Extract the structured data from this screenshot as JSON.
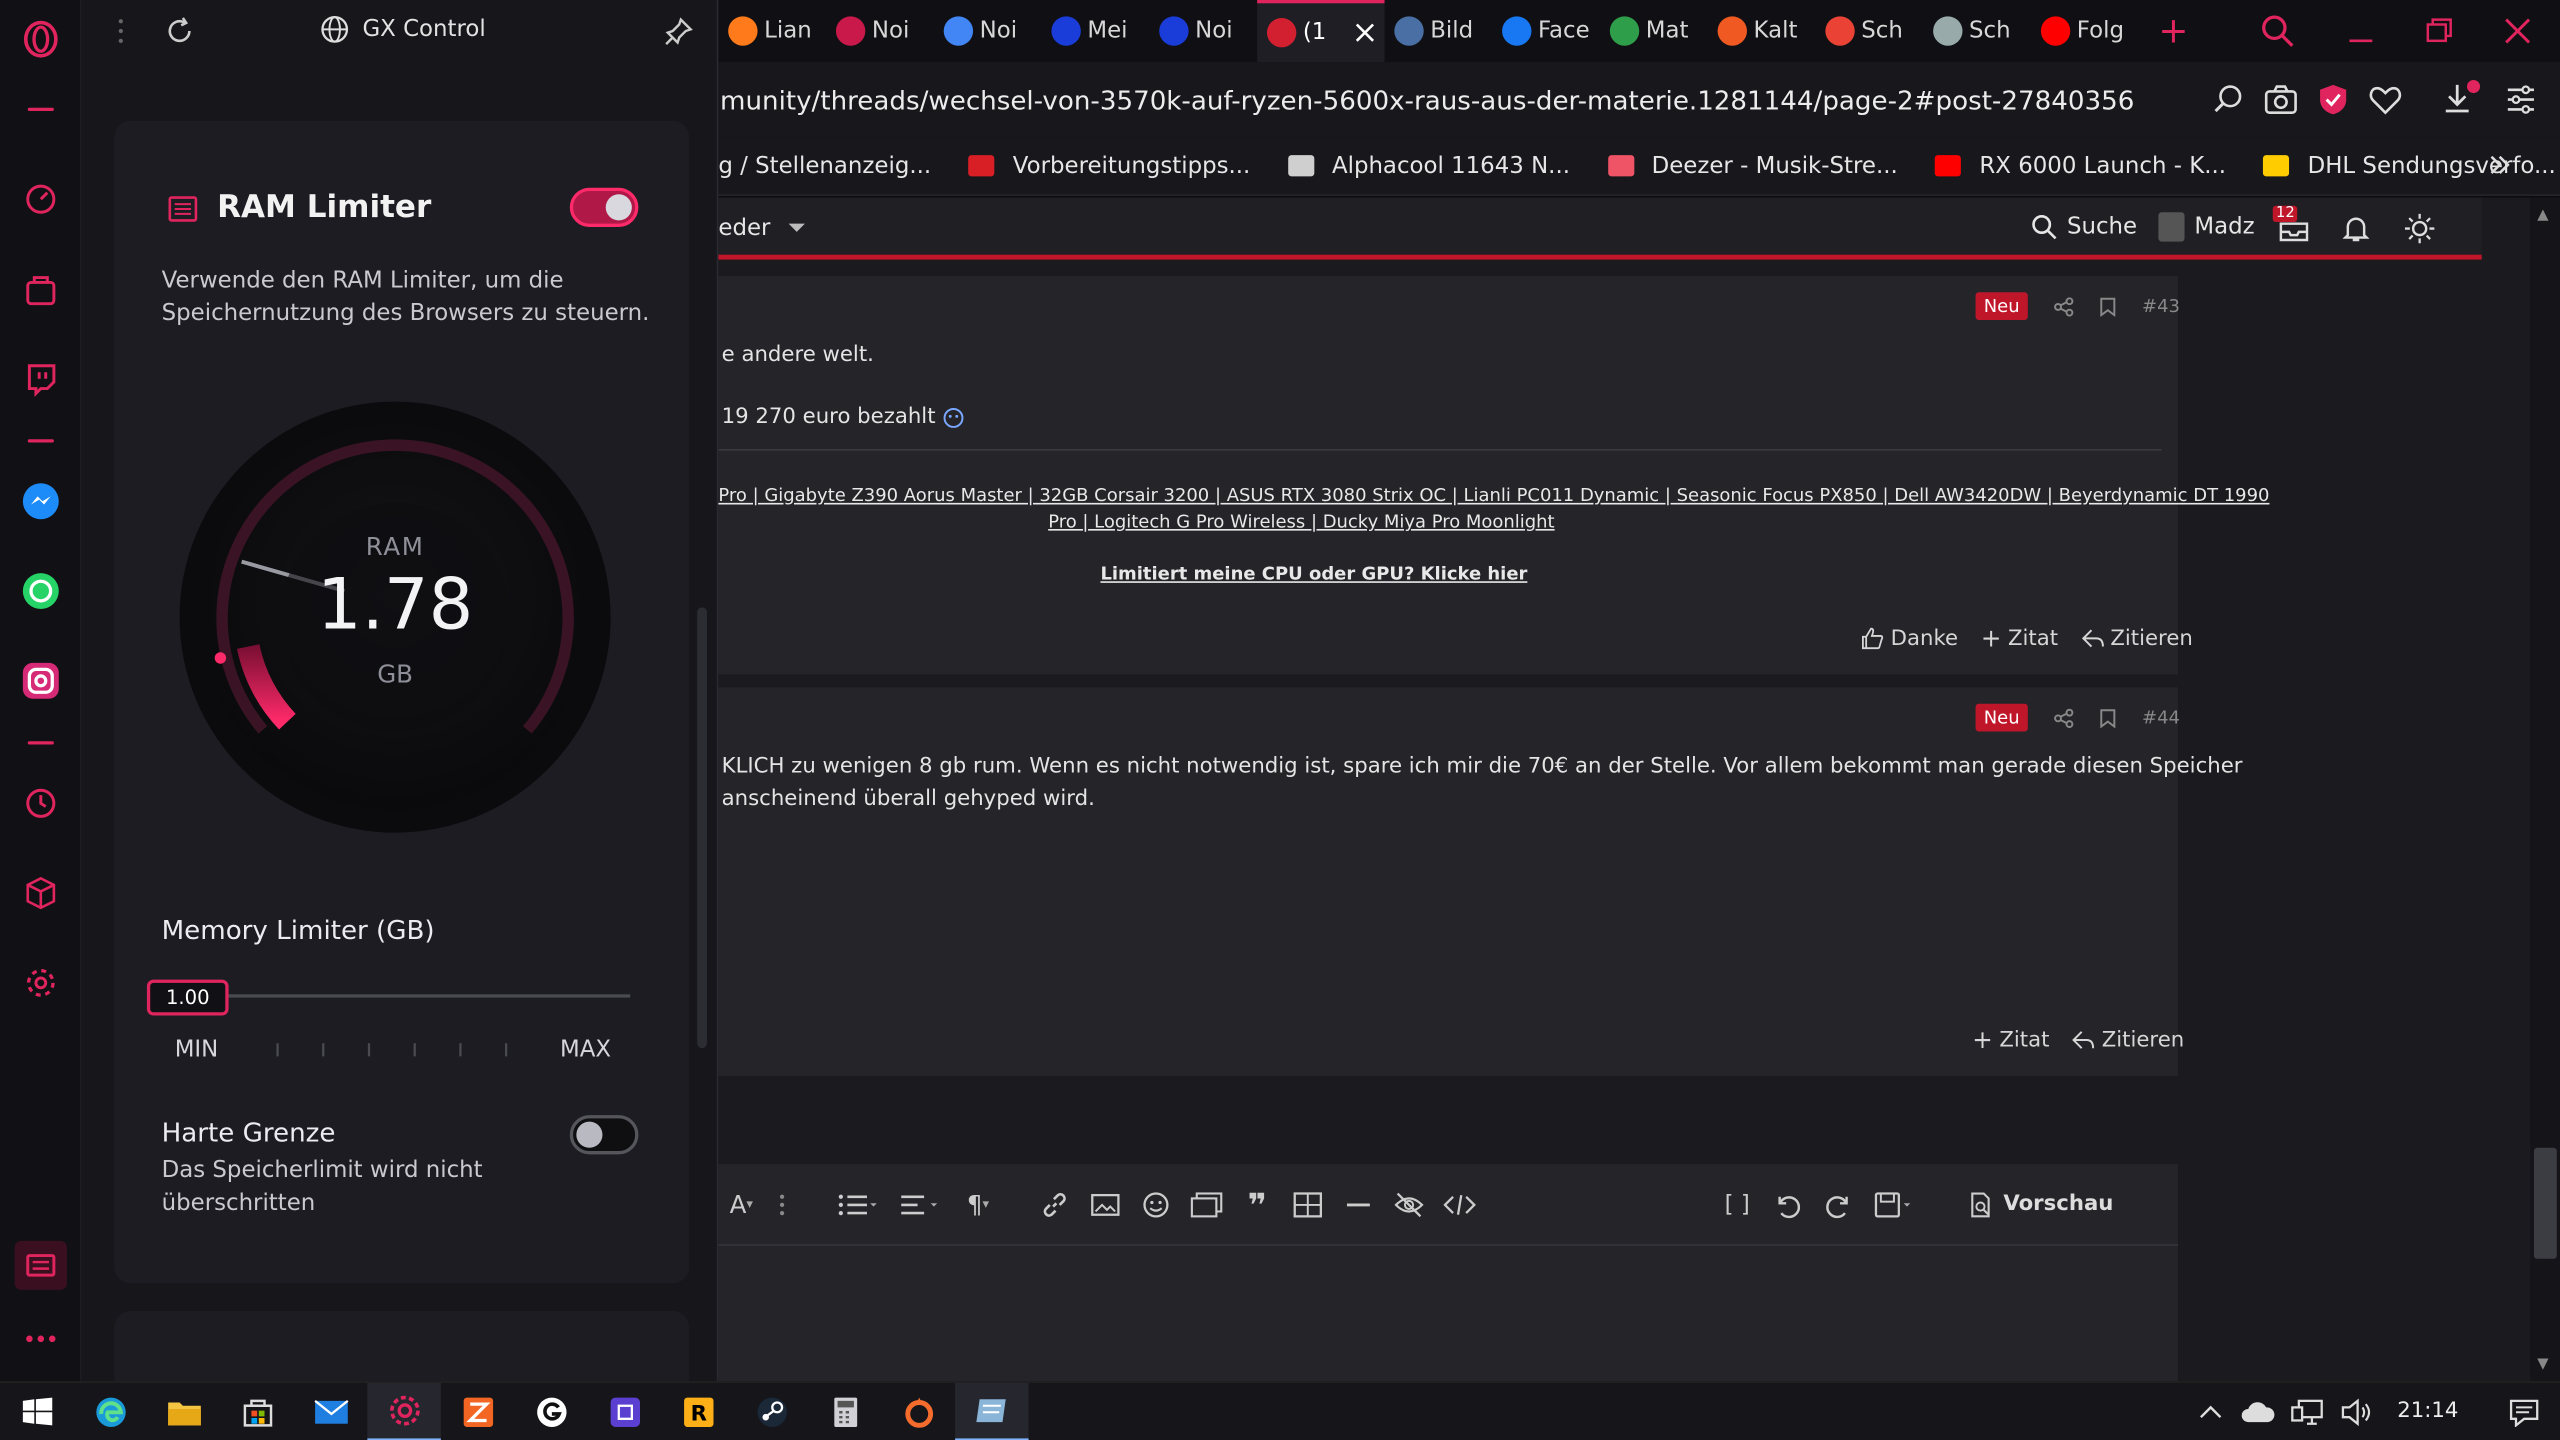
{
  "gx": {
    "panel_title": "GX Control",
    "ram": {
      "title": "RAM Limiter",
      "enabled": true,
      "description_line1": "Verwende den RAM Limiter, um die",
      "description_line2": "Speichernutzung des Browsers zu steuern.",
      "gauge_label": "RAM",
      "gauge_value": "1.78",
      "gauge_unit": "GB",
      "limiter_label": "Memory Limiter (GB)",
      "limiter_value": "1.00",
      "slider_fraction": 0.0,
      "min_label": "MIN",
      "max_label": "MAX",
      "hard_limit_title": "Harte Grenze",
      "hard_limit_enabled": false,
      "hard_limit_desc_line1": "Das Speicherlimit wird nicht",
      "hard_limit_desc_line2": "überschritten"
    }
  },
  "tabs": [
    {
      "label": "Lian",
      "icon": "lianli-icon",
      "color": "#ff7a1a"
    },
    {
      "label": "Noi",
      "icon": "noisebridge-icon",
      "color": "#c9184a"
    },
    {
      "label": "Noi",
      "icon": "google-icon",
      "color": "#4285f4"
    },
    {
      "label": "Mei",
      "icon": "mein-icon",
      "color": "#1a3dd9"
    },
    {
      "label": "Noi",
      "icon": "noise-icon",
      "color": "#1a3dd9"
    },
    {
      "label": "(1",
      "icon": "computerbase-icon",
      "color": "#d32030",
      "active": true
    },
    {
      "label": "Bild",
      "icon": "bild-icon",
      "color": "#4a6fa5"
    },
    {
      "label": "Face",
      "icon": "facebook-icon",
      "color": "#1877f2"
    },
    {
      "label": "Mat",
      "icon": "mat-icon",
      "color": "#2e9e4a"
    },
    {
      "label": "Kalt",
      "icon": "kalt-icon",
      "color": "#f05a22"
    },
    {
      "label": "Sch",
      "icon": "gmail-icon",
      "color": "#ea4335"
    },
    {
      "label": "Sch",
      "icon": "satellite-icon",
      "color": "#9aa"
    },
    {
      "label": "Folg",
      "icon": "youtube-icon",
      "color": "#ff0000"
    }
  ],
  "address": {
    "url": "munity/threads/wechsel-von-3570k-auf-ryzen-5600x-raus-aus-der-materie.1281144/page-2#post-27840356"
  },
  "bookmarks": [
    {
      "label": "g / Stellenanzeig...",
      "icon": "",
      "color": ""
    },
    {
      "label": "Vorbereitungstipps...",
      "icon": "bookmark-r-icon",
      "color": "#d81f26"
    },
    {
      "label": "Alphacool 11643 N...",
      "icon": "cart-icon",
      "color": "#cfcfcf"
    },
    {
      "label": "Deezer - Musik-Stre...",
      "icon": "deezer-icon",
      "color": "#ef5466"
    },
    {
      "label": "RX 6000 Launch - K...",
      "icon": "youtube-icon",
      "color": "#ff0000"
    },
    {
      "label": "DHL Sendungsverfo...",
      "icon": "dhl-icon",
      "color": "#ffcc00"
    }
  ],
  "forum": {
    "nav_label": "eder",
    "search_label": "Suche",
    "user_name": "Madz",
    "inbox_count": "12",
    "post1": {
      "badge": "Neu",
      "number": "#43",
      "line1": "e andere welt.",
      "line2": "19 270 euro bezahlt",
      "sig_line1": "Pro | Gigabyte Z390 Aorus Master | 32GB Corsair 3200 | ASUS RTX 3080 Strix OC | Lianli PC011 Dynamic | Seasonic Focus PX850 | Dell AW3420DW | Beyerdynamic DT 1990",
      "sig_line2": "Pro | Logitech G Pro Wireless | Ducky Miya Pro Moonlight",
      "sig_link": "Limitiert meine CPU oder GPU? Klicke hier",
      "thanks": "Danke",
      "quote": "Zitat",
      "cite": "Zitieren"
    },
    "post2": {
      "badge": "Neu",
      "number": "#44",
      "line1": "KLICH zu wenigen 8 gb rum. Wenn es nicht notwendig ist, spare ich mir die 70€ an der Stelle. Vor allem bekommt man gerade diesen Speicher",
      "line2": "anscheinend überall gehyped wird.",
      "quote": "Zitat",
      "cite": "Zitieren"
    },
    "editor": {
      "preview": "Vorschau"
    }
  },
  "taskbar": {
    "time": "21:14"
  },
  "colors": {
    "accent": "#e0245e",
    "forum_red": "#c0162a"
  }
}
